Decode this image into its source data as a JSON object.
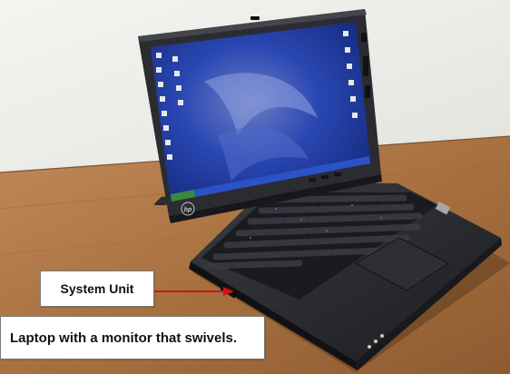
{
  "callouts": {
    "system_unit_label": "System Unit",
    "caption": "Laptop with a monitor that swivels."
  },
  "colors": {
    "wall": "#eeeeea",
    "desk": "#b07a48",
    "laptop_body": "#2a2b2f",
    "screen_blue": "#1f3fa7",
    "arrow": "#d11414"
  },
  "brand_mark": "hp"
}
